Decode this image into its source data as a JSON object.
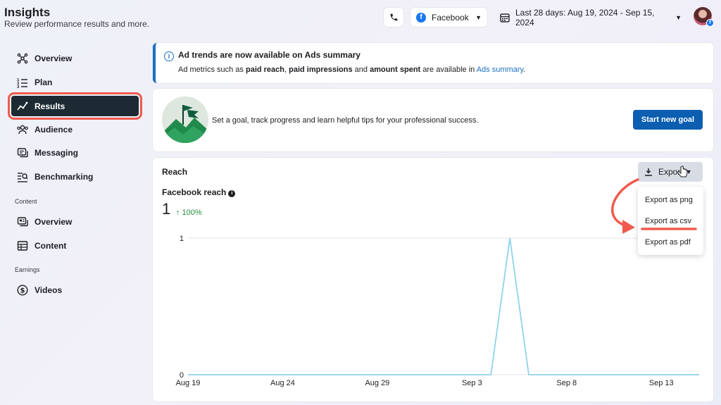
{
  "header": {
    "title": "Insights",
    "subtitle": "Review performance results and more.",
    "platform": "Facebook",
    "date_range": "Last 28 days: Aug 19, 2024 - Sep 15, 2024"
  },
  "icons": {
    "phone": "phone-icon",
    "facebook": "facebook-icon",
    "calendar": "calendar-icon",
    "avatar": "avatar"
  },
  "sidebar": {
    "items": [
      {
        "label": "Overview",
        "icon": "overview-icon"
      },
      {
        "label": "Plan",
        "icon": "plan-icon"
      },
      {
        "label": "Results",
        "icon": "results-icon",
        "active": true
      },
      {
        "label": "Audience",
        "icon": "audience-icon"
      },
      {
        "label": "Messaging",
        "icon": "messaging-icon"
      },
      {
        "label": "Benchmarking",
        "icon": "benchmarking-icon"
      }
    ],
    "content_section": "Content",
    "content_items": [
      {
        "label": "Overview",
        "icon": "content-overview-icon"
      },
      {
        "label": "Content",
        "icon": "content-table-icon"
      }
    ],
    "earnings_section": "Earnings",
    "earnings_items": [
      {
        "label": "Videos",
        "icon": "dollar-icon"
      }
    ]
  },
  "banner": {
    "title": "Ad trends are now available on Ads summary",
    "text_1": "Ad metrics such as ",
    "bold_1": "paid reach",
    "text_2": ", ",
    "bold_2": "paid impressions",
    "text_3": " and ",
    "bold_3": "amount spent",
    "text_4": " are available in ",
    "link": "Ads summary",
    "text_5": "."
  },
  "goal": {
    "text": "Set a goal, track progress and learn helpful tips for your professional success.",
    "button": "Start new goal"
  },
  "reach": {
    "title": "Reach",
    "metric_label": "Facebook reach",
    "value": "1",
    "delta": "↑ 100%",
    "export_button": "Export",
    "export_menu": [
      "Export as png",
      "Export as csv",
      "Export as pdf"
    ]
  },
  "colors": {
    "accent": "#0b5eb0",
    "active_nav": "#1c2b33",
    "highlight": "#ef5b4d",
    "line": "#8fd3ec",
    "positive": "#1e8e3e"
  },
  "chart_data": {
    "type": "line",
    "x": [
      "Aug 19",
      "Aug 20",
      "Aug 21",
      "Aug 22",
      "Aug 23",
      "Aug 24",
      "Aug 25",
      "Aug 26",
      "Aug 27",
      "Aug 28",
      "Aug 29",
      "Aug 30",
      "Aug 31",
      "Sep 1",
      "Sep 2",
      "Sep 3",
      "Sep 4",
      "Sep 5",
      "Sep 6",
      "Sep 7",
      "Sep 8",
      "Sep 9",
      "Sep 10",
      "Sep 11",
      "Sep 12",
      "Sep 13",
      "Sep 14",
      "Sep 15"
    ],
    "values": [
      0,
      0,
      0,
      0,
      0,
      0,
      0,
      0,
      0,
      0,
      0,
      0,
      0,
      0,
      0,
      0,
      0,
      1,
      0,
      0,
      0,
      0,
      0,
      0,
      0,
      0,
      0,
      0
    ],
    "x_ticks": [
      "Aug 19",
      "Aug 24",
      "Aug 29",
      "Sep 3",
      "Sep 8",
      "Sep 13"
    ],
    "y_ticks": [
      0,
      1
    ],
    "ylim": [
      0,
      1
    ],
    "grid": true,
    "legend": "none"
  }
}
